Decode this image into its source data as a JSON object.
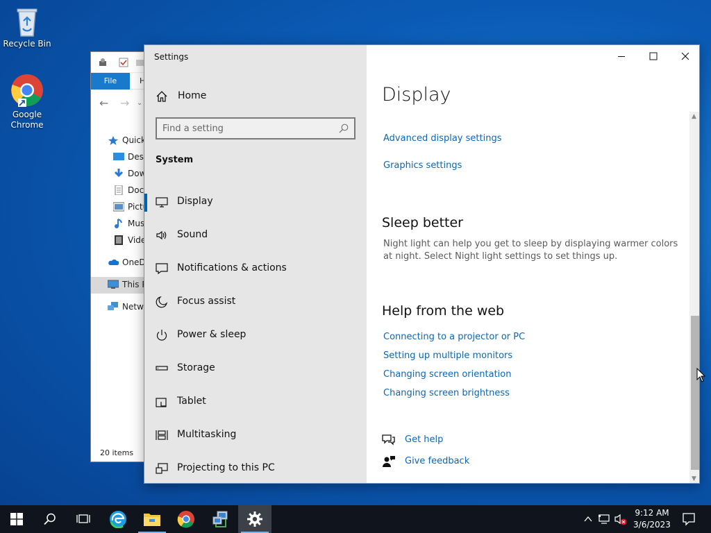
{
  "desktop": {
    "icons": [
      {
        "label": "Recycle Bin",
        "icon": "recycle-bin-icon"
      },
      {
        "label": "Google Chrome",
        "icon": "chrome-icon"
      }
    ]
  },
  "explorer": {
    "ribbon_file": "File",
    "ribbon_home_partial": "H",
    "tree": [
      {
        "label": "Quick",
        "icon": "star-icon"
      },
      {
        "label": "Desk",
        "icon": "desktop-folder-icon"
      },
      {
        "label": "Dow",
        "icon": "downloads-icon"
      },
      {
        "label": "Docu",
        "icon": "documents-icon"
      },
      {
        "label": "Pictu",
        "icon": "pictures-icon"
      },
      {
        "label": "Musi",
        "icon": "music-icon"
      },
      {
        "label": "Vide",
        "icon": "videos-icon"
      },
      {
        "label": "OneDr",
        "icon": "onedrive-icon"
      },
      {
        "label": "This P",
        "icon": "this-pc-icon"
      },
      {
        "label": "Netwo",
        "icon": "network-icon"
      }
    ],
    "status": "20 items"
  },
  "settings": {
    "window_title": "Settings",
    "home_label": "Home",
    "search_placeholder": "Find a setting",
    "section_label": "System",
    "nav": [
      {
        "label": "Display",
        "icon": "monitor-icon",
        "active": true
      },
      {
        "label": "Sound",
        "icon": "speaker-icon"
      },
      {
        "label": "Notifications & actions",
        "icon": "notifications-icon"
      },
      {
        "label": "Focus assist",
        "icon": "moon-icon"
      },
      {
        "label": "Power & sleep",
        "icon": "power-icon"
      },
      {
        "label": "Storage",
        "icon": "storage-icon"
      },
      {
        "label": "Tablet",
        "icon": "tablet-icon"
      },
      {
        "label": "Multitasking",
        "icon": "multitasking-icon"
      },
      {
        "label": "Projecting to this PC",
        "icon": "projecting-icon"
      }
    ],
    "content": {
      "title": "Display",
      "related_links": [
        "Advanced display settings",
        "Graphics settings"
      ],
      "sleep_heading": "Sleep better",
      "sleep_text": "Night light can help you get to sleep by displaying warmer colors at night. Select Night light settings to set things up.",
      "web_heading": "Help from the web",
      "web_links": [
        "Connecting to a projector or PC",
        "Setting up multiple monitors",
        "Changing screen orientation",
        "Changing screen brightness"
      ],
      "get_help": "Get help",
      "give_feedback": "Give feedback"
    }
  },
  "taskbar": {
    "apps": [
      "start-icon",
      "search-icon",
      "task-view-icon",
      "edge-icon",
      "file-explorer-icon",
      "chrome-icon",
      "network-app-icon",
      "settings-gear-icon"
    ],
    "time": "9:12 AM",
    "date": "3/6/2023"
  },
  "colors": {
    "accent": "#0063b1",
    "link": "#0a66b7",
    "taskbar": "#10151d"
  }
}
